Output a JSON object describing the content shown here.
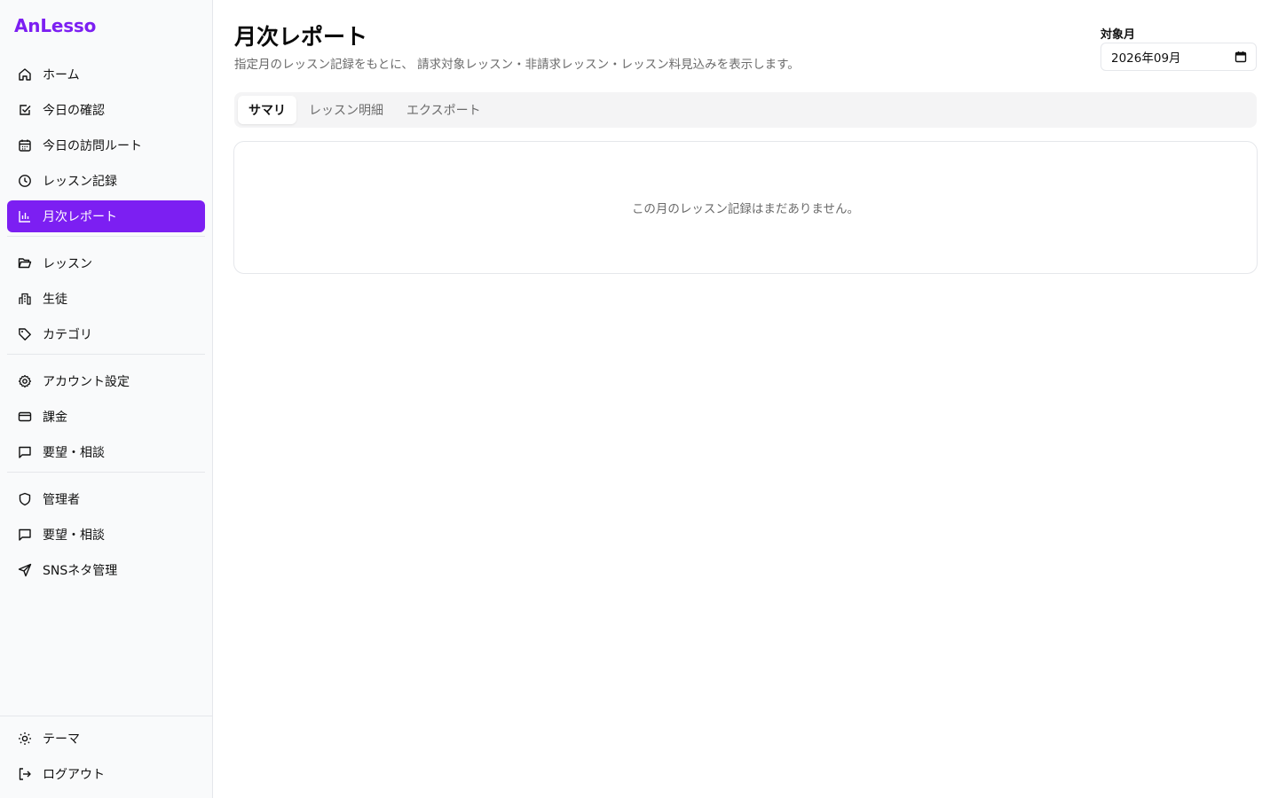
{
  "brand": "AnLesso",
  "colors": {
    "accent": "#7c1ff2",
    "sidebar_bg": "#f9fafb",
    "border": "#e5e7eb",
    "muted_text": "#6b6b6b"
  },
  "sidebar": {
    "groups": [
      [
        {
          "label": "ホーム",
          "icon": "home-icon"
        },
        {
          "label": "今日の確認",
          "icon": "check-square-icon"
        },
        {
          "label": "今日の訪問ルート",
          "icon": "calendar-icon"
        },
        {
          "label": "レッスン記録",
          "icon": "clock-icon"
        },
        {
          "label": "月次レポート",
          "icon": "bar-chart-icon",
          "active": true
        }
      ],
      [
        {
          "label": "レッスン",
          "icon": "folder-open-icon"
        },
        {
          "label": "生徒",
          "icon": "building-icon"
        },
        {
          "label": "カテゴリ",
          "icon": "tag-icon"
        }
      ],
      [
        {
          "label": "アカウント設定",
          "icon": "gear-icon"
        },
        {
          "label": "課金",
          "icon": "credit-card-icon"
        },
        {
          "label": "要望・相談",
          "icon": "message-square-icon"
        }
      ],
      [
        {
          "label": "管理者",
          "icon": "shield-icon"
        },
        {
          "label": "要望・相談",
          "icon": "message-square-icon"
        },
        {
          "label": "SNSネタ管理",
          "icon": "send-icon"
        }
      ]
    ],
    "bottom": [
      {
        "label": "テーマ",
        "icon": "sun-icon"
      },
      {
        "label": "ログアウト",
        "icon": "logout-icon"
      }
    ]
  },
  "header": {
    "title": "月次レポート",
    "subtitle": "指定月のレッスン記録をもとに、 請求対象レッスン・非請求レッスン・レッスン料見込みを表示します。",
    "month_label": "対象月",
    "month_value": "2026年09月"
  },
  "tabs": [
    {
      "label": "サマリ",
      "active": true
    },
    {
      "label": "レッスン明細"
    },
    {
      "label": "エクスポート"
    }
  ],
  "empty_message": "この月のレッスン記録はまだありません。"
}
